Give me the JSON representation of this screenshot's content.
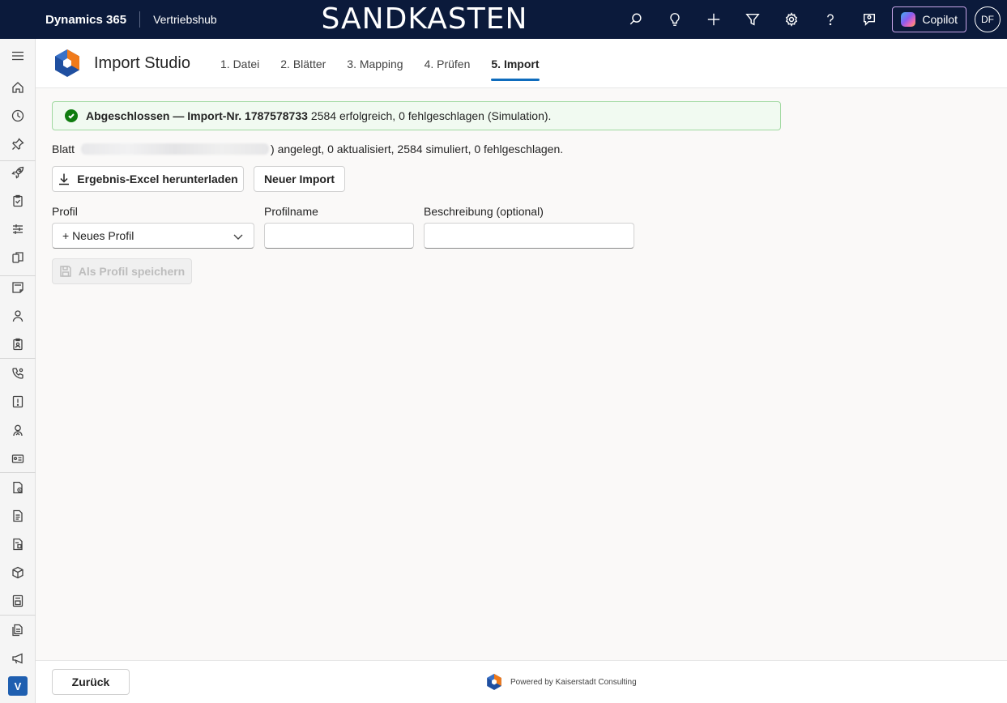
{
  "topbar": {
    "brand": "Dynamics 365",
    "app": "Vertriebshub",
    "environment": "SANDKASTEN",
    "copilot_label": "Copilot",
    "avatar_initials": "DF"
  },
  "studio": {
    "title": "Import Studio",
    "steps": [
      {
        "label": "1. Datei"
      },
      {
        "label": "2. Blätter"
      },
      {
        "label": "3. Mapping"
      },
      {
        "label": "4. Prüfen"
      },
      {
        "label": "5. Import",
        "active": true
      }
    ]
  },
  "result": {
    "status_bold": "Abgeschlossen — Import-Nr. 1787578733",
    "status_rest": "2584 erfolgreich, 0 fehlgeschlagen (Simulation).",
    "sheet_prefix": "Blatt",
    "sheet_suffix": ") angelegt, 0 aktualisiert, 2584 simuliert, 0 fehlgeschlagen."
  },
  "actions": {
    "download_label": "Ergebnis-Excel herunterladen",
    "new_import_label": "Neuer Import"
  },
  "profile": {
    "profil_label": "Profil",
    "profil_value": "+ Neues Profil",
    "profilname_label": "Profilname",
    "profilname_value": "",
    "beschreibung_label": "Beschreibung (optional)",
    "beschreibung_value": "",
    "save_label": "Als Profil speichern"
  },
  "footer": {
    "back_label": "Zurück",
    "powered_by": "Powered by Kaiserstadt Consulting"
  },
  "leftnav": {
    "area_letter": "V"
  },
  "colors": {
    "topbar": "#0b1a3b",
    "accent": "#0f6cbd",
    "success": "#107c10",
    "logo_orange": "#f07a1a",
    "logo_blue": "#1f4fa0"
  }
}
